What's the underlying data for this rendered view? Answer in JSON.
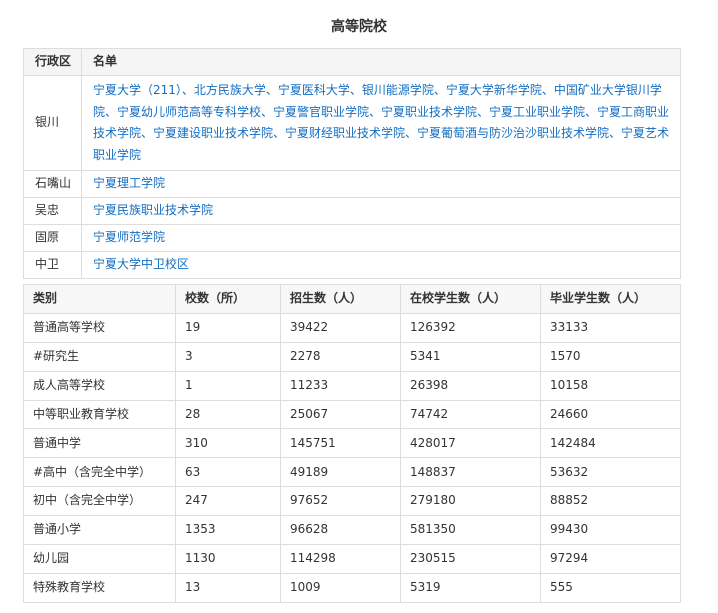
{
  "title": "高等院校",
  "institutions": {
    "headers": [
      "行政区",
      "名单"
    ],
    "rows": [
      {
        "region": "银川",
        "names": "宁夏大学（211）、北方民族大学、宁夏医科大学、银川能源学院、宁夏大学新华学院、中国矿业大学银川学院、宁夏幼儿师范高等专科学校、宁夏警官职业学院、宁夏职业技术学院、宁夏工业职业学院、宁夏工商职业技术学院、宁夏建设职业技术学院、宁夏财经职业技术学院、宁夏葡萄酒与防沙治沙职业技术学院、宁夏艺术职业学院"
      },
      {
        "region": "石嘴山",
        "names": "宁夏理工学院"
      },
      {
        "region": "吴忠",
        "names": "宁夏民族职业技术学院"
      },
      {
        "region": "固原",
        "names": "宁夏师范学院"
      },
      {
        "region": "中卫",
        "names": "宁夏大学中卫校区"
      }
    ]
  },
  "stats": {
    "headers": [
      "类别",
      "校数（所）",
      "招生数（人）",
      "在校学生数（人）",
      "毕业学生数（人）"
    ],
    "rows": [
      [
        "普通高等学校",
        "19",
        "39422",
        "126392",
        "33133"
      ],
      [
        "#研究生",
        "3",
        "2278",
        "5341",
        "1570"
      ],
      [
        "成人高等学校",
        "1",
        "11233",
        "26398",
        "10158"
      ],
      [
        "中等职业教育学校",
        "28",
        "25067",
        "74742",
        "24660"
      ],
      [
        "普通中学",
        "310",
        "145751",
        "428017",
        "142484"
      ],
      [
        "#高中（含完全中学）",
        "63",
        "49189",
        "148837",
        "53632"
      ],
      [
        "初中（含完全中学）",
        "247",
        "97652",
        "279180",
        "88852"
      ],
      [
        "普通小学",
        "1353",
        "96628",
        "581350",
        "99430"
      ],
      [
        "幼儿园",
        "1130",
        "114298",
        "230515",
        "97294"
      ],
      [
        "特殊教育学校",
        "13",
        "1009",
        "5319",
        "555"
      ]
    ]
  }
}
